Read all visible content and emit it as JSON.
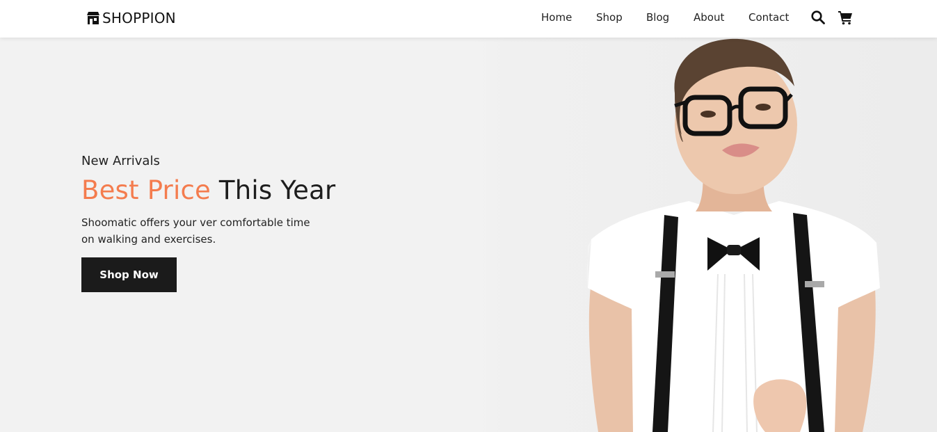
{
  "brand": {
    "name": "SHOPPION",
    "logo_icon": "storefront-icon"
  },
  "nav": {
    "links": [
      "Home",
      "Shop",
      "Blog",
      "About",
      "Contact"
    ],
    "icons": [
      "search-icon",
      "cart-icon"
    ]
  },
  "hero": {
    "eyebrow": "New Arrivals",
    "headline_accent": "Best Price",
    "headline_rest": "This Year",
    "description_line1": "Shoomatic offers your ver comfortable time",
    "description_line2": "on walking and exercises.",
    "cta_label": "Shop Now"
  },
  "colors": {
    "accent": "#f47c4e",
    "button": "#1b1b1b",
    "background": "#f2f2f2",
    "navbar": "#ffffff"
  }
}
